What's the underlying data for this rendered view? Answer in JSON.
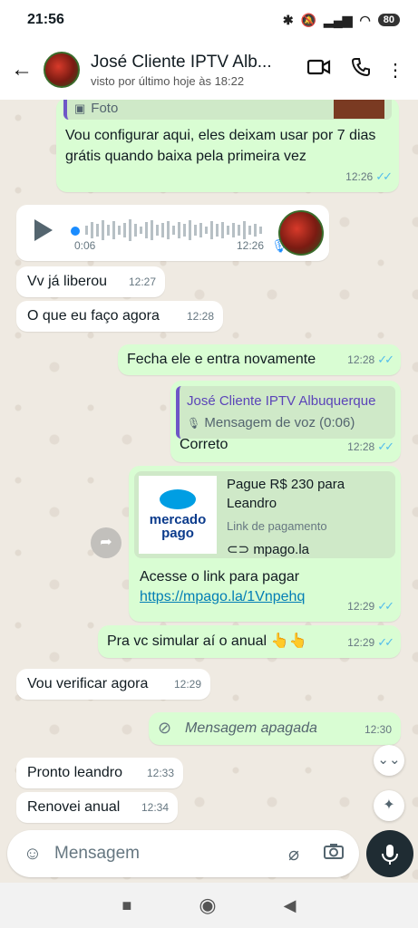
{
  "status_bar": {
    "time": "21:56",
    "battery": "80"
  },
  "header": {
    "contact_name": "José Cliente IPTV Alb...",
    "last_seen": "visto por último hoje às 18:22"
  },
  "messages": {
    "m1": {
      "quote_label": "Foto",
      "text": "Vou configurar aqui, eles deixam usar por 7 dias grátis quando baixa pela primeira vez",
      "time": "12:26"
    },
    "m2": {
      "duration": "0:06",
      "time": "12:26"
    },
    "m3": {
      "text": "Vv já liberou",
      "time": "12:27"
    },
    "m4": {
      "text": "O que eu faço agora",
      "time": "12:28"
    },
    "m5": {
      "text": "Fecha ele e entra novamente",
      "time": "12:28"
    },
    "m6": {
      "quote_name": "José Cliente IPTV Albuquerque",
      "quote_sub": "Mensagem de voz (0:06)",
      "text": "Correto",
      "time": "12:28"
    },
    "m7": {
      "logo_line1": "mercado",
      "logo_line2": "pago",
      "preview_title": "Pague R$ 230 para Leandro",
      "preview_sub": "Link de pagamento",
      "preview_domain": "mpago.la",
      "text": "Acesse o link para pagar",
      "link": "https://mpago.la/1Vnpehq",
      "time": "12:29"
    },
    "m8": {
      "text": "Pra vc simular aí o anual 👆👆",
      "time": "12:29"
    },
    "m9": {
      "text": "Vou verificar agora",
      "time": "12:29"
    },
    "m10": {
      "text": "Mensagem apagada",
      "time": "12:30"
    },
    "m11": {
      "text": "Pronto leandro",
      "time": "12:33"
    },
    "m12": {
      "text": "Renovei anual",
      "time": "12:34"
    }
  },
  "composer": {
    "placeholder": "Mensagem"
  },
  "icons": {
    "back": "arrow-left",
    "video": "video-camera",
    "call": "phone",
    "menu": "more-vertical",
    "emoji": "sticker",
    "attach": "paperclip",
    "camera": "camera",
    "mic": "microphone"
  }
}
